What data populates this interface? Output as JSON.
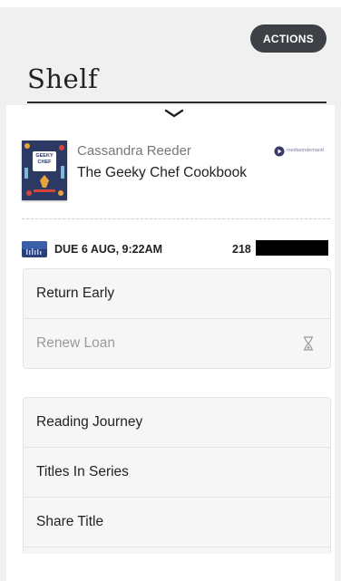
{
  "header": {
    "title": "Shelf",
    "actions_label": "ACTIONS"
  },
  "book": {
    "author": "Cassandra Reeder",
    "title": "The Geeky Chef Cookbook",
    "cover_text": "GEEKY CHEF",
    "publisher_logo": "mediaondemand"
  },
  "loan": {
    "due": "DUE 6 AUG, 9:22AM",
    "id_prefix": "218"
  },
  "loan_actions": [
    {
      "label": "Return Early",
      "disabled": false
    },
    {
      "label": "Renew Loan",
      "disabled": true
    }
  ],
  "title_actions": [
    {
      "label": "Reading Journey"
    },
    {
      "label": "Titles In Series"
    },
    {
      "label": "Share Title"
    }
  ],
  "icons": {
    "expand": "chevron-down-icon",
    "renew_status": "hourglass-icon",
    "format": "audiobook-icon"
  },
  "colors": {
    "actions_button": "#3d4146",
    "background": "#f0f0f0",
    "card": "#ffffff",
    "disabled_text": "#9a9a9a"
  }
}
